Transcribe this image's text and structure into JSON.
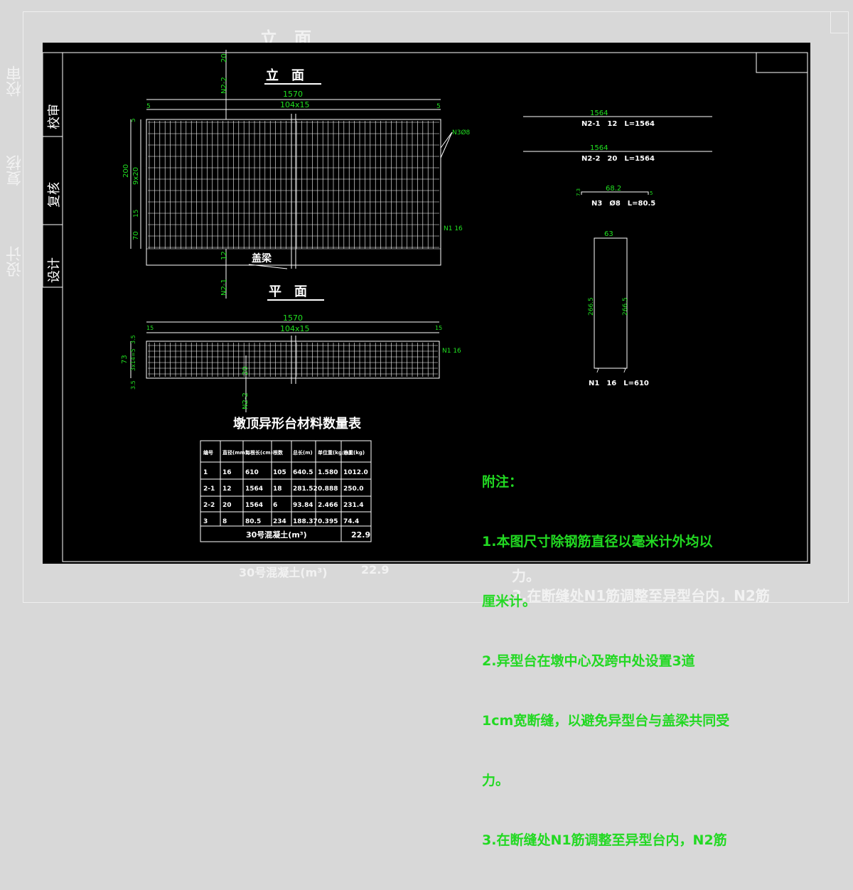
{
  "side_labels": [
    "校审",
    "复核",
    "设计"
  ],
  "elevation": {
    "title": "立　面",
    "dim_total": "1570",
    "dim_spacing": "104x15",
    "dim_end": "5",
    "left_dims": [
      "5",
      "200",
      "9x20",
      "15",
      "70"
    ],
    "tag_n2_2": "N2-2",
    "tag_n2_2_val": "20",
    "tag_n2_1": "N2-1",
    "tag_n2_1_val": "12",
    "tag_n3": "N3Ø8",
    "tag_n1": "N1 16",
    "beam_label": "盖梁"
  },
  "plan": {
    "title": "平　面",
    "dim_total": "1570",
    "dim_spacing": "104x15",
    "dim_end": "15",
    "left_dims": [
      "73",
      "3.5",
      "3x14=5",
      "3.5"
    ],
    "tag_n2_2": "N2-2",
    "tag_n2_2_val": "20",
    "tag_n1": "N1 16"
  },
  "details": {
    "n21_len": "1564",
    "n21_label": "N2-1　12　L=1564",
    "n22_len": "1564",
    "n22_label": "N2-2　20　L=1564",
    "n3_len": "68.2",
    "n3_end_l": "7.3",
    "n3_end_r": "5",
    "n3_label": "N3　Ø8　L=80.5",
    "n1_top": "63",
    "n1_side_l": "266.5",
    "n1_side_r": "266.5",
    "n1_foot_l": "7",
    "n1_foot_r": "7",
    "n1_label": "N1　16　L=610"
  },
  "table": {
    "title": "墩顶异形台材料数量表",
    "headers": [
      "编号",
      "直径(mm)",
      "每根长(cm)",
      "根数",
      "总长(m)",
      "单位重(kg/m)",
      "总重(kg)"
    ],
    "rows": [
      [
        "1",
        "16",
        "610",
        "105",
        "640.5",
        "1.580",
        "1012.0"
      ],
      [
        "2-1",
        "12",
        "1564",
        "18",
        "281.52",
        "0.888",
        "250.0"
      ],
      [
        "2-2",
        "20",
        "1564",
        "6",
        "93.84",
        "2.466",
        "231.4"
      ],
      [
        "3",
        "8",
        "80.5",
        "234",
        "188.37",
        "0.395",
        "74.4"
      ]
    ],
    "footer_label": "30号混凝土(m³)",
    "footer_value": "22.9"
  },
  "notes": {
    "title": "附注：",
    "lines": [
      "1.本图尺寸除钢筋直径以毫米计外均以",
      "厘米计。",
      "2.异型台在墩中心及跨中处设置3道",
      "1cm宽断缝，以避免异型台与盖梁共同受",
      "力。",
      "3.在断缝处N1筋调整至异型台内，N2筋"
    ]
  },
  "colors": {
    "line": "#ffffff",
    "text": "#21e021",
    "background": "#000000"
  }
}
